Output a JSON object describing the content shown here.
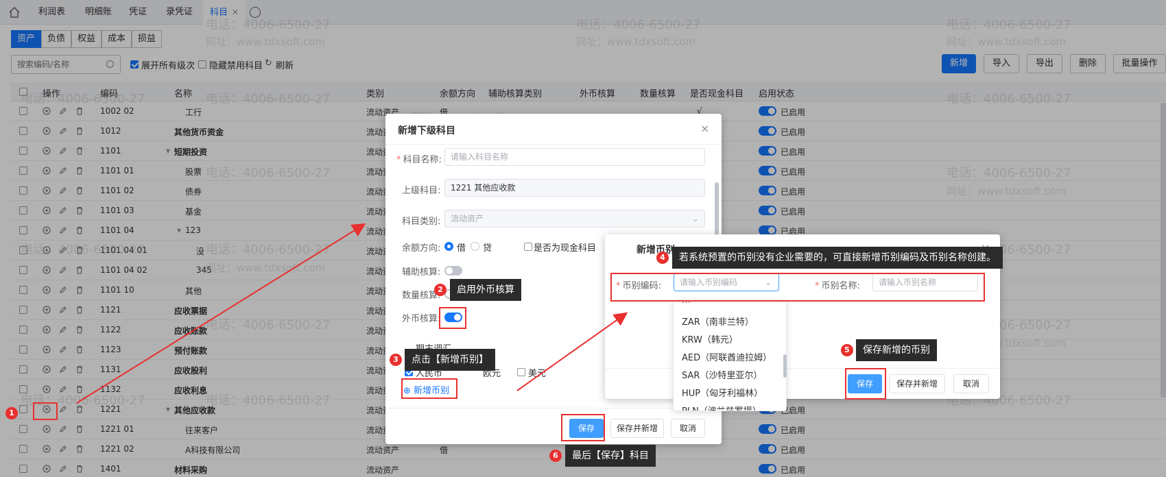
{
  "top_tabs": [
    "利润表",
    "明细账",
    "凭证",
    "录凭证",
    "科目"
  ],
  "top_tab_close": "✕",
  "categories": [
    "资产",
    "负债",
    "权益",
    "成本",
    "损益"
  ],
  "search": {
    "placeholder": "搜索编码/名称"
  },
  "toolbar": {
    "expand_label": "展开所有级次",
    "hide_disabled_label": "隐藏禁用科目",
    "refresh_label": "刷新",
    "buttons": [
      "新增",
      "导入",
      "导出",
      "删除",
      "批量操作"
    ]
  },
  "columns": [
    "操作",
    "编码",
    "名称",
    "类别",
    "余额方向",
    "辅助核算类别",
    "外币核算",
    "数量核算",
    "是否现金科目",
    "启用状态"
  ],
  "rows": [
    {
      "code": "1002 02",
      "name": "工行",
      "type": "流动资产",
      "dir": "借",
      "cash": "√",
      "status": "已启用"
    },
    {
      "code": "1012",
      "name": "其他货币资金",
      "type": "流动资产",
      "dir": "",
      "cash": "",
      "status": "已启用"
    },
    {
      "code": "1101",
      "name": "短期投资",
      "type": "流动资产",
      "dir": "",
      "cash": "",
      "status": "已启用"
    },
    {
      "code": "1101 01",
      "name": "股票",
      "type": "流动资产",
      "dir": "",
      "cash": "",
      "status": "已启用"
    },
    {
      "code": "1101 02",
      "name": "债券",
      "type": "流动资产",
      "dir": "",
      "cash": "",
      "status": "已启用"
    },
    {
      "code": "1101 03",
      "name": "基金",
      "type": "流动资产",
      "dir": "",
      "cash": "",
      "status": "已启用"
    },
    {
      "code": "1101 04",
      "name": "123",
      "type": "流动资产",
      "dir": "",
      "cash": "",
      "status": "已启用"
    },
    {
      "code": "1101 04 01",
      "name": "没",
      "type": "流动资产",
      "dir": "",
      "cash": "",
      "status": "已启用"
    },
    {
      "code": "1101 04 02",
      "name": "345",
      "type": "流动资产",
      "dir": "",
      "cash": "",
      "status": "已启用"
    },
    {
      "code": "1101 10",
      "name": "其他",
      "type": "流动资产",
      "dir": "",
      "cash": "",
      "status": "已启用"
    },
    {
      "code": "1121",
      "name": "应收票据",
      "type": "流动资产",
      "dir": "",
      "cash": "",
      "status": "已启用"
    },
    {
      "code": "1122",
      "name": "应收账款",
      "type": "流动资产",
      "dir": "",
      "cash": "",
      "status": "已启用"
    },
    {
      "code": "1123",
      "name": "预付账款",
      "type": "流动资产",
      "dir": "",
      "cash": "",
      "status": "已启用"
    },
    {
      "code": "1131",
      "name": "应收股利",
      "type": "流动资产",
      "dir": "",
      "cash": "",
      "status": "已启用"
    },
    {
      "code": "1132",
      "name": "应收利息",
      "type": "流动资产",
      "dir": "",
      "cash": "",
      "status": "已启用"
    },
    {
      "code": "1221",
      "name": "其他应收款",
      "type": "流动资产",
      "dir": "",
      "cash": "",
      "status": "已启用"
    },
    {
      "code": "1221 01",
      "name": "往来客户",
      "type": "流动资产",
      "dir": "",
      "cash": "",
      "status": "已启用"
    },
    {
      "code": "1221 02",
      "name": "A科技有限公司",
      "type": "流动资产",
      "dir": "借",
      "cash": "",
      "status": "已启用"
    },
    {
      "code": "1401",
      "name": "材料采购",
      "type": "流动资产",
      "dir": "",
      "cash": "",
      "status": "已启用"
    }
  ],
  "dialog1": {
    "title": "新增下级科目",
    "name_label": "科目名称:",
    "name_placeholder": "请输入科目名称",
    "parent_label": "上级科目:",
    "parent_value": "1221 其他应收款",
    "type_label": "科目类别:",
    "type_value": "流动资产",
    "dir_label": "余额方向:",
    "dir_debit": "借",
    "dir_credit": "贷",
    "cash_label": "是否为现金科目",
    "aux_label": "辅助核算:",
    "qty_label": "数量核算:",
    "fx_label": "外币核算:",
    "period_label": "期末调汇",
    "currency_rmb": "人民币",
    "currency_eur": "欧元",
    "currency_usd": "美元",
    "add_currency": "新增币别",
    "save": "保存",
    "save_new": "保存并新增",
    "cancel": "取消"
  },
  "dialog2": {
    "title": "新增币别",
    "code_label": "币别编码:",
    "code_placeholder": "请输入币别编码",
    "name_label": "币别名称:",
    "name_placeholder": "请输入币别名称",
    "save": "保存",
    "save_new": "保存并新增",
    "cancel": "取消"
  },
  "dropdown": [
    "ZAR（南非兰特）",
    "KRW（韩元）",
    "AED（阿联酋迪拉姆）",
    "SAR（沙特里亚尔）",
    "HUP（匈牙利福林）",
    "PLN（波兰兹罗提）"
  ],
  "tips": {
    "t2": "启用外币核算",
    "t3": "点击【新增币别】",
    "t4": "若系统预置的币别没有企业需要的，可直接新增币别编码及币别名称创建。",
    "t5": "保存新增的币别",
    "t6": "最后【保存】科目"
  },
  "steps": [
    "1",
    "2",
    "3",
    "4",
    "5",
    "6"
  ],
  "watermark": {
    "phone": "电话：4006-6500-27",
    "site": "网址：www.tdxsoft.com"
  },
  "colors": {
    "primary": "#1677ff",
    "annotation": "#e8302e",
    "tooltip": "#2b2b2b"
  }
}
